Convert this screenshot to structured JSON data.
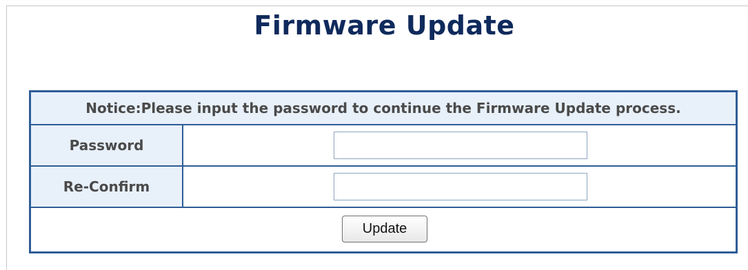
{
  "page": {
    "title": "Firmware Update"
  },
  "form": {
    "notice": "Notice:Please input the password to continue the Firmware Update process.",
    "password": {
      "label": "Password",
      "value": "",
      "placeholder": ""
    },
    "reconfirm": {
      "label": "Re-Confirm",
      "value": "",
      "placeholder": ""
    },
    "update_button": "Update"
  },
  "colors": {
    "title": "#0f2a5c",
    "table_border": "#2f5d96",
    "label_background": "#e8f0fa",
    "label_text": "#4a4a4a"
  }
}
